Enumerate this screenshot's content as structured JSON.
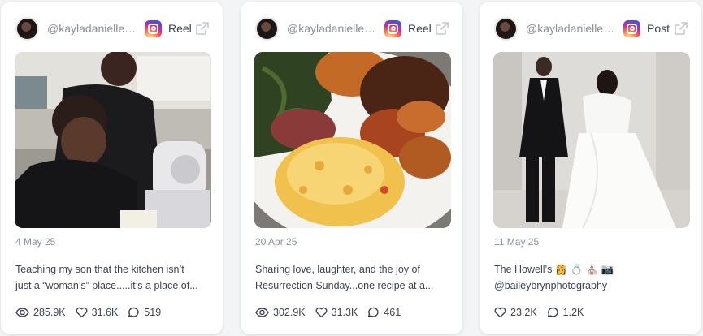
{
  "colors": {
    "card_bg": "#ffffff",
    "muted_text": "#8a8f9e",
    "body_text": "#3d4253",
    "page_bg": "#f3f4f6"
  },
  "posts": [
    {
      "handle": "@kayladaniellea...",
      "platform_icon": "instagram-icon",
      "type": "Reel",
      "date": "4 May 25",
      "caption_line1": "Teaching my son that the kitchen isn’t",
      "caption_line2": "just a “woman’s” place.....it’s a place of...",
      "stats": {
        "views": "285.9K",
        "likes": "31.6K",
        "comments": "519"
      }
    },
    {
      "handle": "@kayladaniellea...",
      "platform_icon": "instagram-icon",
      "type": "Reel",
      "date": "20 Apr 25",
      "caption_line1": "Sharing love, laughter, and the joy of",
      "caption_line2": "Resurrection Sunday...one recipe at a...",
      "stats": {
        "views": "302.9K",
        "likes": "31.3K",
        "comments": "461"
      }
    },
    {
      "handle": "@kayladaniellea...",
      "platform_icon": "instagram-icon",
      "type": "Post",
      "date": "11 May 25",
      "caption_line1": "The Howell’s 👸 💍 ⛪ 📷",
      "caption_line2": "@baileybrynphotography",
      "stats": {
        "likes": "23.2K",
        "comments": "1.2K"
      }
    }
  ]
}
